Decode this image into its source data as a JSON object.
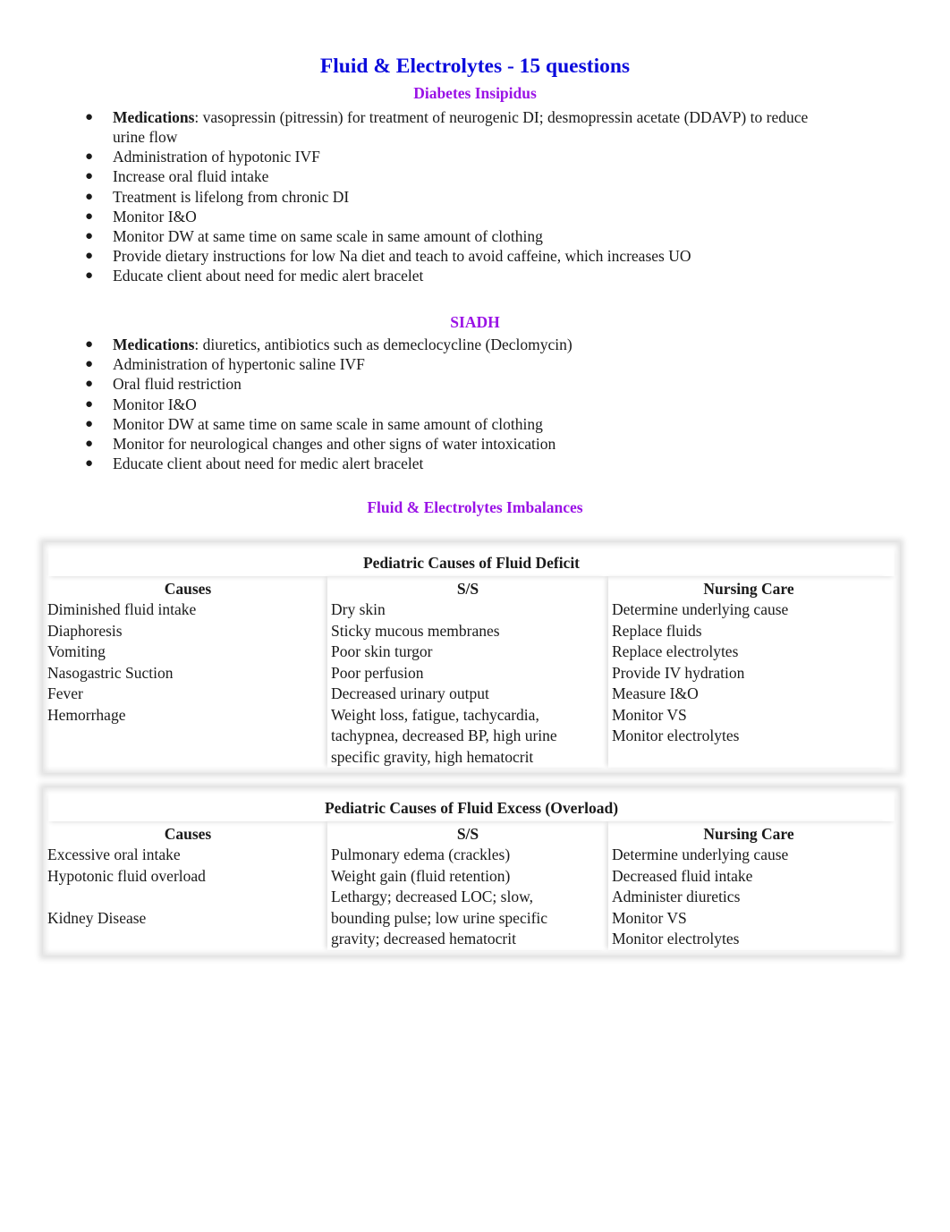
{
  "document": {
    "title": "Fluid & Electrolytes - 15 questions",
    "colors": {
      "title": "#0b0bdc",
      "subheading": "#9a12e6",
      "text": "#1a1a1a"
    }
  },
  "diabetes_insipidus": {
    "heading": "Diabetes Insipidus",
    "items": [
      {
        "bold": "Medications",
        "text": ": vasopressin (pitressin) for treatment of neurogenic DI; desmopressin acetate (DDAVP) to reduce",
        "continuation": "urine flow"
      },
      {
        "bold": "",
        "text": "Administration of hypotonic IVF"
      },
      {
        "bold": "",
        "text": "Increase oral fluid intake"
      },
      {
        "bold": "",
        "text": "Treatment is lifelong from chronic DI"
      },
      {
        "bold": "",
        "text": "Monitor I&O"
      },
      {
        "bold": "",
        "text": "Monitor DW at same time on same scale in same amount of clothing"
      },
      {
        "bold": "",
        "text": "Provide dietary instructions for low Na diet and teach to avoid caffeine, which increases UO"
      },
      {
        "bold": "",
        "text": "Educate client about need for medic alert bracelet"
      }
    ]
  },
  "siadh": {
    "heading": "SIADH",
    "items": [
      {
        "bold": "Medications",
        "text": ": diuretics, antibiotics such as demeclocycline (Declomycin)"
      },
      {
        "bold": "",
        "text": "Administration of hypertonic saline IVF"
      },
      {
        "bold": "",
        "text": "Oral fluid restriction"
      },
      {
        "bold": "",
        "text": "Monitor I&O"
      },
      {
        "bold": "",
        "text": "Monitor DW at same time on same scale in same amount of clothing"
      },
      {
        "bold": "",
        "text": "Monitor for neurological changes and other signs of water intoxication"
      },
      {
        "bold": "",
        "text": "Educate client about need for medic alert bracelet"
      }
    ]
  },
  "imbalances": {
    "heading": "Fluid & Electrolytes Imbalances",
    "tables": [
      {
        "title": "Pediatric Causes of Fluid Deficit",
        "headers": [
          "Causes",
          "S/S",
          "Nursing Care"
        ],
        "columns": [
          [
            "Diminished fluid intake",
            "Diaphoresis",
            "Vomiting",
            "Nasogastric Suction",
            "Fever",
            "Hemorrhage",
            "",
            ""
          ],
          [
            "Dry skin",
            "Sticky mucous membranes",
            "Poor skin turgor",
            "Poor perfusion",
            "Decreased urinary output",
            "Weight loss, fatigue, tachycardia,",
            "tachypnea, decreased BP, high urine",
            "specific gravity, high hematocrit"
          ],
          [
            "Determine underlying cause",
            "Replace fluids",
            "Replace electrolytes",
            "Provide IV hydration",
            "Measure I&O",
            "Monitor VS",
            "Monitor electrolytes",
            ""
          ]
        ]
      },
      {
        "title": "Pediatric Causes of Fluid Excess (Overload)",
        "headers": [
          "Causes",
          "S/S",
          "Nursing Care"
        ],
        "columns": [
          [
            "Excessive oral intake",
            "Hypotonic fluid overload",
            "",
            "Kidney Disease",
            ""
          ],
          [
            "Pulmonary edema (crackles)",
            "Weight gain (fluid retention)",
            "Lethargy; decreased LOC; slow,",
            "bounding pulse; low urine specific",
            "gravity; decreased hematocrit"
          ],
          [
            "Determine underlying cause",
            "Decreased fluid intake",
            "Administer diuretics",
            "Monitor VS",
            "Monitor electrolytes"
          ]
        ]
      }
    ]
  }
}
